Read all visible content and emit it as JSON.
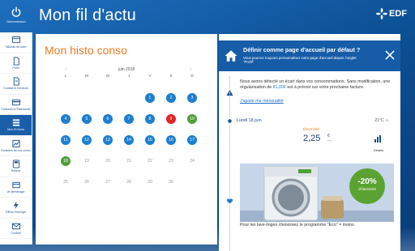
{
  "header": {
    "logout_label": "Déconnexion",
    "title": "Mon fil d'actu",
    "brand": "EDF"
  },
  "sidebar": {
    "items": [
      {
        "label": "Tableau de bord",
        "icon": "dashboard-icon"
      },
      {
        "label": "Profil",
        "icon": "profile-icon"
      },
      {
        "label": "Contrat et Services",
        "icon": "contract-icon"
      },
      {
        "label": "Factures et Paiements",
        "icon": "invoice-icon"
      },
      {
        "label": "Mon fil d'actu",
        "icon": "feed-icon",
        "active": true
      },
      {
        "label": "Evolution de ma conso",
        "icon": "evolution-icon"
      },
      {
        "label": "Relevé",
        "icon": "meter-icon"
      },
      {
        "label": "Je déménage",
        "icon": "moving-icon"
      },
      {
        "label": "Offres d'énergie",
        "icon": "energy-icon"
      },
      {
        "label": "Contact",
        "icon": "mail-icon"
      }
    ]
  },
  "main": {
    "title": "Mon histo conso",
    "calendar": {
      "month": "juin 2018",
      "prev": "‹",
      "next": "›",
      "weekdays": [
        "L",
        "M",
        "M",
        "J",
        "V",
        "S",
        "D"
      ],
      "weeks": [
        [
          {
            "d": ""
          },
          {
            "d": ""
          },
          {
            "d": ""
          },
          {
            "d": ""
          },
          {
            "d": "1",
            "s": "blue"
          },
          {
            "d": "2",
            "s": "blue"
          },
          {
            "d": "3",
            "s": "blue"
          }
        ],
        [
          {
            "d": "4",
            "s": "blue"
          },
          {
            "d": "5",
            "s": "blue"
          },
          {
            "d": "6",
            "s": "blue"
          },
          {
            "d": "7",
            "s": "blue"
          },
          {
            "d": "8",
            "s": "blue"
          },
          {
            "d": "9",
            "s": "red"
          },
          {
            "d": "10",
            "s": "green"
          }
        ],
        [
          {
            "d": "11",
            "s": "blue"
          },
          {
            "d": "12",
            "s": "blue"
          },
          {
            "d": "13",
            "s": "blue"
          },
          {
            "d": "14",
            "s": "blue"
          },
          {
            "d": "15",
            "s": "blue"
          },
          {
            "d": "16",
            "s": "blue"
          },
          {
            "d": "17",
            "s": "blue"
          }
        ],
        [
          {
            "d": "18",
            "s": "green"
          },
          {
            "d": "19",
            "s": "grey"
          },
          {
            "d": "20",
            "s": "grey"
          },
          {
            "d": "21",
            "s": "grey"
          },
          {
            "d": "22",
            "s": "grey"
          },
          {
            "d": "23",
            "s": "grey"
          },
          {
            "d": "24",
            "s": "grey"
          }
        ],
        [
          {
            "d": "25",
            "s": "grey"
          },
          {
            "d": "26",
            "s": "grey"
          },
          {
            "d": "27",
            "s": "grey"
          },
          {
            "d": "28",
            "s": "grey"
          },
          {
            "d": "29",
            "s": "grey"
          },
          {
            "d": "30",
            "s": "grey"
          },
          {
            "d": ""
          }
        ]
      ]
    }
  },
  "feed": {
    "banner": {
      "title": "Définir comme page d'accueil par défaut ?",
      "subtitle": "Vous pourrez toujours personnaliser votre page d'accueil depuis l'onglet \"Profil\""
    },
    "alert": {
      "text_before": "Nous avons détecté un écart dans vos consommations. Sans modification, une régularisation de ",
      "amount": "81,00€",
      "text_after": " est à prévoir sur votre prochaine facture.",
      "link": "J'ajuste ma mensualité"
    },
    "day": {
      "label": "Lundi 18 juin",
      "temperature": "21°C"
    },
    "conso": {
      "energy": "Électricité",
      "value": "2,25",
      "unit": "€",
      "ttc": "TTC",
      "details": "Détails"
    },
    "promo": {
      "badge_pct": "-20%",
      "badge_label": "d'électricité",
      "text": "Pour les lave-linges choisissez le programme \"Eco\" = moins"
    }
  },
  "colors": {
    "accent": "#f07a1f",
    "brand_blue": "#165ca7",
    "day_blue": "#1d7fd0",
    "day_red": "#e32527",
    "day_green": "#4f9f3a"
  }
}
